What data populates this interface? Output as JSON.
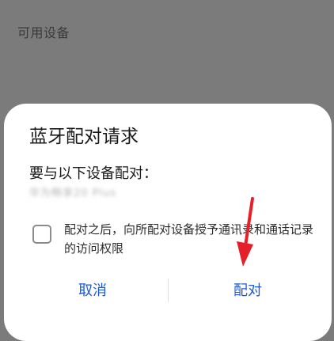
{
  "background": {
    "section_header": "可用设备"
  },
  "dialog": {
    "title": "蓝牙配对请求",
    "prompt": "要与以下设备配对：",
    "device_name": "华为畅享20 Plus",
    "checkbox": {
      "checked": false,
      "label": "配对之后，向所配对设备授予通讯录和通话记录的访问权限"
    },
    "buttons": {
      "cancel": "取消",
      "pair": "配对"
    }
  },
  "colors": {
    "scrim": "#7b7b7b",
    "dialog_bg": "#ffffff",
    "accent": "#1d5ad6",
    "annotation_arrow": "#e5202a"
  }
}
